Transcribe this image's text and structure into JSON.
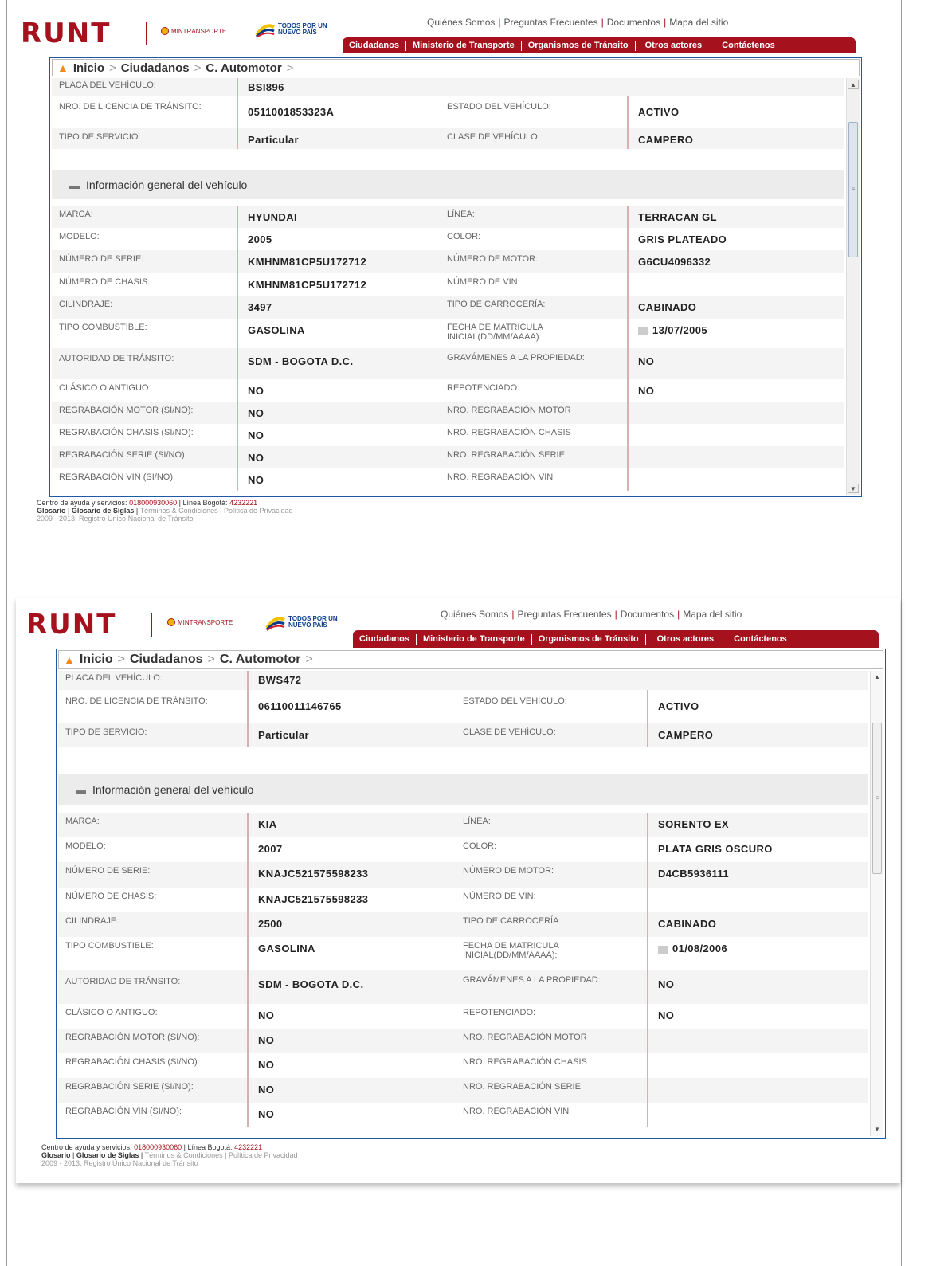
{
  "brand": {
    "logo": "RUNT",
    "ministry": "MINTRANSPORTE",
    "slogan_line1": "TODOS POR UN",
    "slogan_line2": "NUEVO PAÍS"
  },
  "top_links": [
    "Quiénes Somos",
    "Preguntas Frecuentes",
    "Documentos",
    "Mapa del sitio"
  ],
  "nav": [
    "Ciudadanos",
    "Ministerio de Transporte",
    "Organismos de Tránsito",
    "Otros actores",
    "Contáctenos"
  ],
  "breadcrumb": [
    "Inicio",
    "Ciudadanos",
    "C. Automotor"
  ],
  "section_title": "Información general del vehículo",
  "labels": {
    "placa": "PLACA DEL VEHÍCULO:",
    "licencia": "NRO. DE LICENCIA DE TRÁNSITO:",
    "estado": "ESTADO DEL VEHÍCULO:",
    "servicio": "TIPO DE SERVICIO:",
    "clase": "CLASE DE VEHÍCULO:",
    "marca": "MARCA:",
    "linea": "LÍNEA:",
    "modelo": "MODELO:",
    "color": "COLOR:",
    "serie": "NÚMERO DE SERIE:",
    "motor": "NÚMERO DE MOTOR:",
    "chasis": "NÚMERO DE CHASIS:",
    "vin": "NÚMERO DE VIN:",
    "cilindraje": "CILINDRAJE:",
    "carroceria": "TIPO DE CARROCERÍA:",
    "combustible": "TIPO COMBUSTIBLE:",
    "fecha": "FECHA DE MATRICULA INICIAL(DD/MM/AAAA):",
    "autoridad": "AUTORIDAD DE TRÁNSITO:",
    "gravamenes": "GRAVÁMENES A LA PROPIEDAD:",
    "clasico": "CLÁSICO O ANTIGUO:",
    "repotenciado": "REPOTENCIADO:",
    "reg_motor": "REGRABACIÓN MOTOR (SI/NO):",
    "nro_reg_motor": "NRO. REGRABACIÓN MOTOR",
    "reg_chasis": "REGRABACIÓN CHASIS (SI/NO):",
    "nro_reg_chasis": "NRO. REGRABACIÓN CHASIS",
    "reg_serie": "REGRABACIÓN SERIE (SI/NO):",
    "nro_reg_serie": "NRO. REGRABACIÓN SERIE",
    "reg_vin": "REGRABACIÓN VIN (SI/NO):",
    "nro_reg_vin": "NRO. REGRABACIÓN VIN"
  },
  "vehicles": [
    {
      "placa": "BSI896",
      "licencia": "0511001853323A",
      "estado": "ACTIVO",
      "servicio": "Particular",
      "clase": "CAMPERO",
      "marca": "HYUNDAI",
      "linea": "TERRACAN GL",
      "modelo": "2005",
      "color": "GRIS PLATEADO",
      "serie": "KMHNM81CP5U172712",
      "motor": "G6CU4096332",
      "chasis": "KMHNM81CP5U172712",
      "vin": "",
      "cilindraje": "3497",
      "carroceria": "CABINADO",
      "combustible": "GASOLINA",
      "fecha": "13/07/2005",
      "autoridad": "SDM - BOGOTA D.C.",
      "gravamenes": "NO",
      "clasico": "NO",
      "repotenciado": "NO",
      "reg_motor": "NO",
      "nro_reg_motor": "",
      "reg_chasis": "NO",
      "nro_reg_chasis": "",
      "reg_serie": "NO",
      "nro_reg_serie": "",
      "reg_vin": "NO",
      "nro_reg_vin": ""
    },
    {
      "placa": "BWS472",
      "licencia": "06110011146765",
      "estado": "ACTIVO",
      "servicio": "Particular",
      "clase": "CAMPERO",
      "marca": "KIA",
      "linea": "SORENTO EX",
      "modelo": "2007",
      "color": "PLATA GRIS OSCURO",
      "serie": "KNAJC521575598233",
      "motor": "D4CB5936111",
      "chasis": "KNAJC521575598233",
      "vin": "",
      "cilindraje": "2500",
      "carroceria": "CABINADO",
      "combustible": "GASOLINA",
      "fecha": "01/08/2006",
      "autoridad": "SDM - BOGOTA D.C.",
      "gravamenes": "NO",
      "clasico": "NO",
      "repotenciado": "NO",
      "reg_motor": "NO",
      "nro_reg_motor": "",
      "reg_chasis": "NO",
      "nro_reg_chasis": "",
      "reg_serie": "NO",
      "nro_reg_serie": "",
      "reg_vin": "NO",
      "nro_reg_vin": ""
    }
  ],
  "footer": {
    "help_label": "Centro de ayuda y servicios:",
    "help_phone": "018000930060",
    "bogota_label": "Línea Bogotá:",
    "bogota_phone": "4232221",
    "glosario": "Glosario",
    "glosario_siglas": "Glosario de Siglas",
    "terminos": "Términos & Condiciones",
    "privacidad": "Política de Privacidad",
    "copyright": "2009 - 2013, Registro Único Nacional de Tránsito"
  },
  "colors": {
    "brand_red": "#a5121d",
    "panel_border": "#1d5aa1",
    "row_shade": "#f4f4f4",
    "section_bg": "#ececec"
  }
}
